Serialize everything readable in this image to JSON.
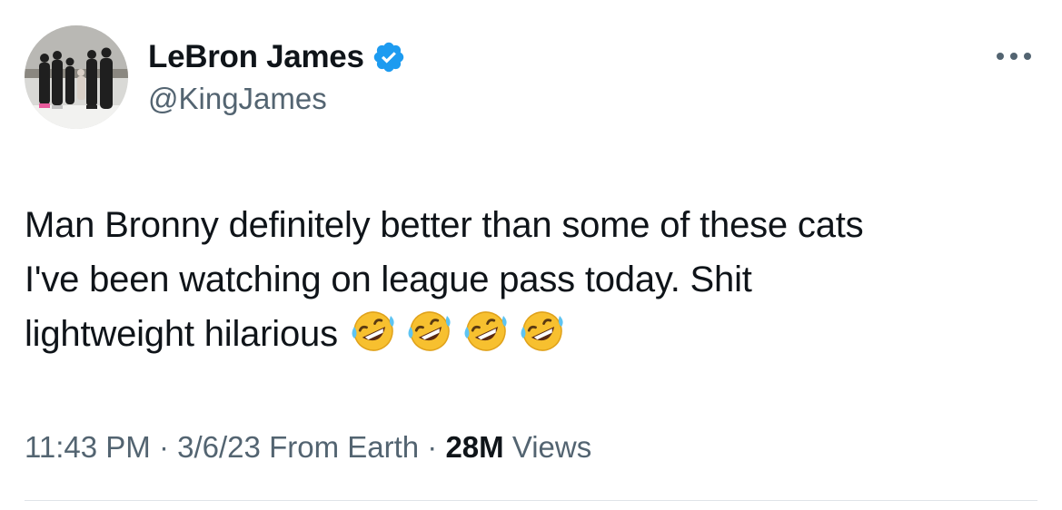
{
  "author": {
    "display_name": "LeBron James",
    "handle": "@KingJames",
    "verified": true,
    "avatar_icon": "group-photo-avatar"
  },
  "tweet": {
    "lines": [
      "Man Bronny definitely better than some of these cats",
      "I've been watching on league pass today.  Shit",
      "lightweight hilarious"
    ],
    "emoji": [
      "🤣",
      "🤣",
      "🤣",
      "🤣"
    ]
  },
  "meta": {
    "time": "11:43 PM",
    "sep1": " · ",
    "date": "3/6/23",
    "source": "From Earth",
    "sep2": " · ",
    "views_count": "28M",
    "views_label": "Views"
  },
  "colors": {
    "verified_blue": "#1d9bf0",
    "secondary_text": "#536471",
    "primary_text": "#0f1419"
  },
  "icons": {
    "more": "more-dots-icon",
    "verified": "verified-badge-icon",
    "emoji": "rolling-on-floor-laughing-emoji"
  }
}
